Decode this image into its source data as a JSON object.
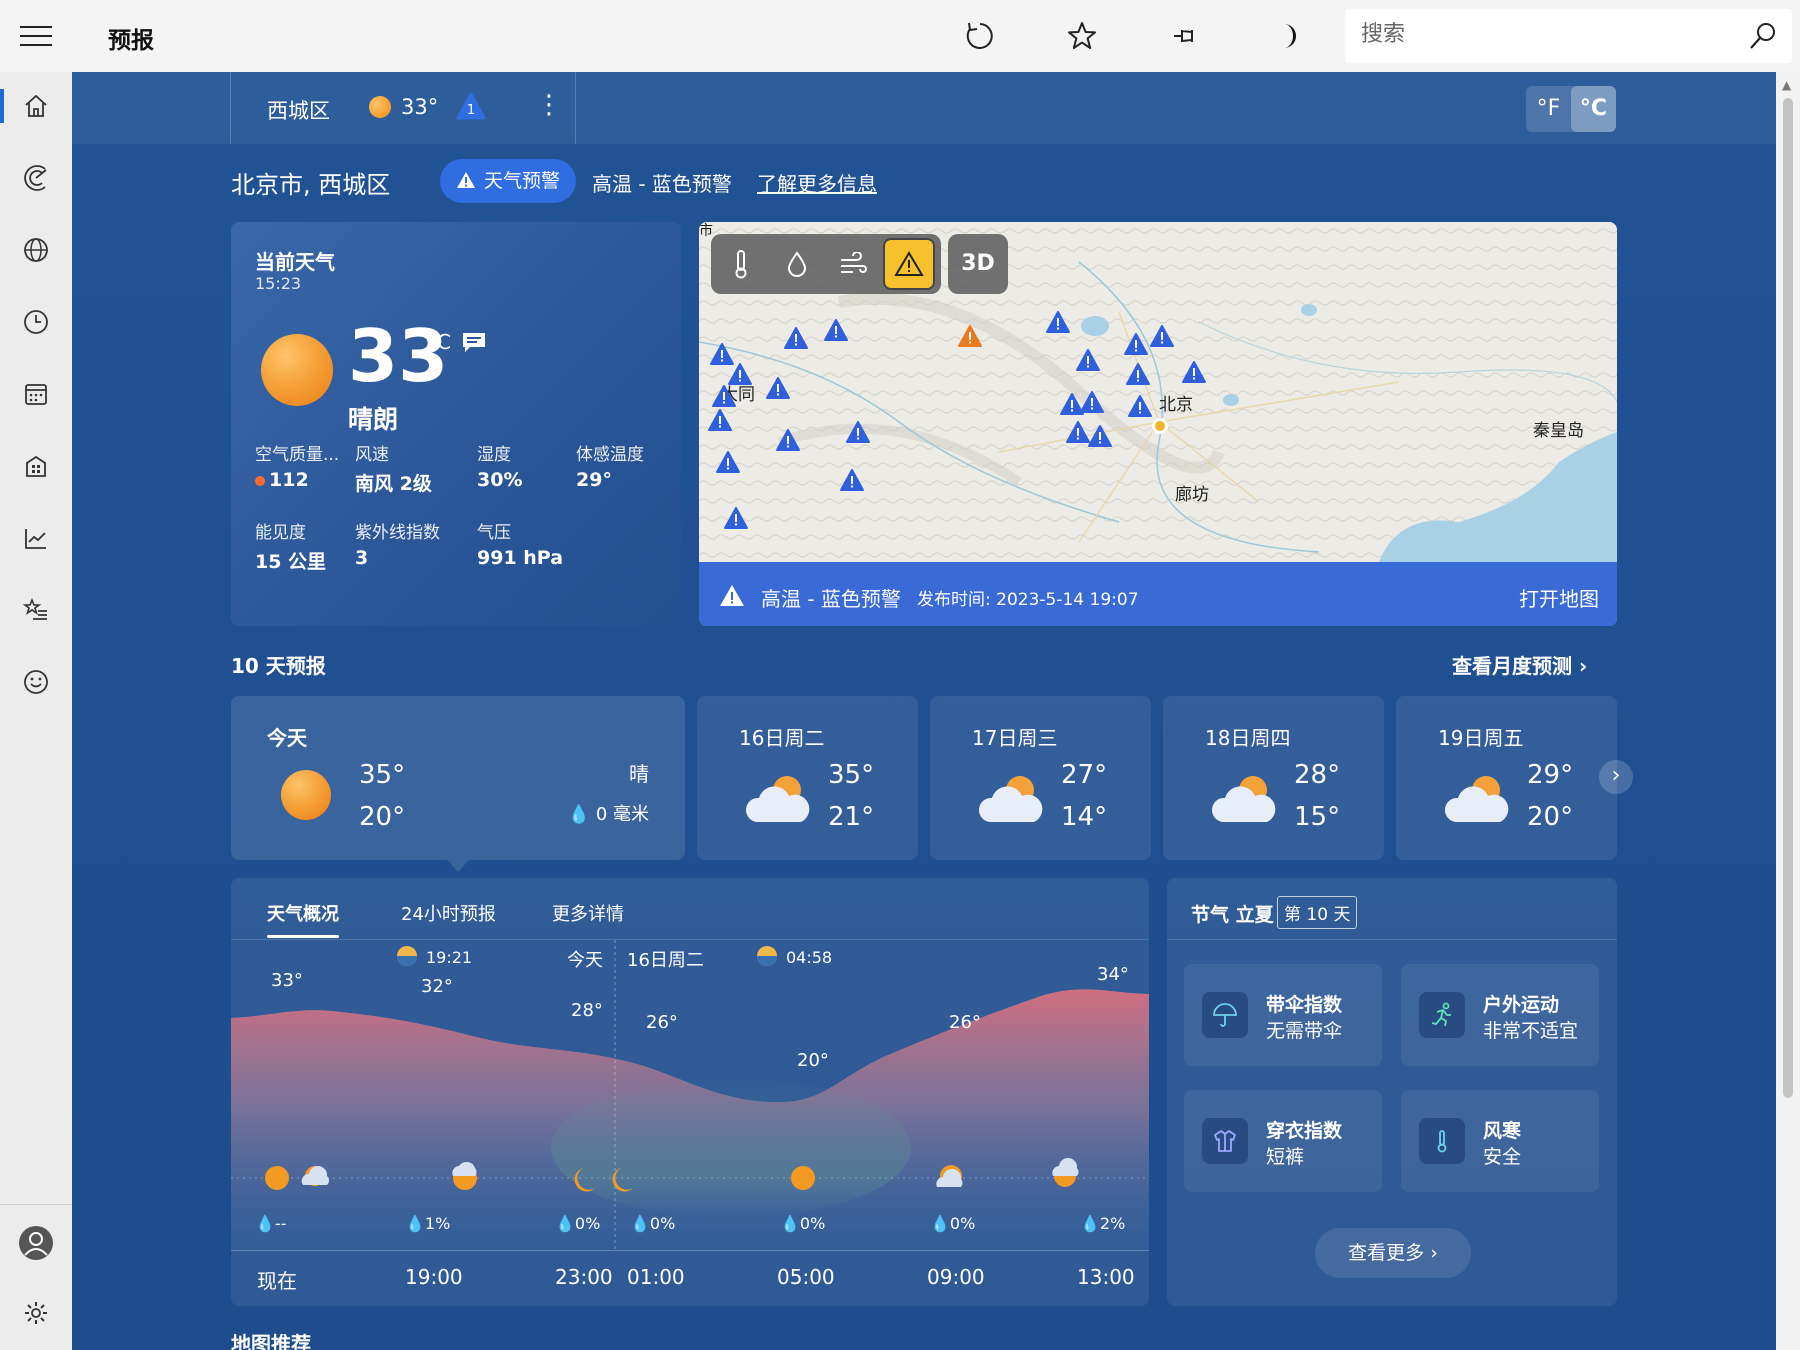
{
  "app": {
    "title": "预报"
  },
  "search": {
    "placeholder": "搜索"
  },
  "toolbar": {
    "icons": [
      "refresh-icon",
      "star-icon",
      "pin-icon",
      "moon-icon"
    ]
  },
  "nav": {
    "items": [
      "home-icon",
      "radar-icon",
      "globe-icon",
      "clock-icon",
      "calendar-icon",
      "building-icon",
      "chart-icon",
      "favorites-icon",
      "smile-icon"
    ],
    "bottom": [
      "avatar-icon",
      "gear-icon"
    ]
  },
  "location_bar": {
    "name": "西城区",
    "temp": "33°",
    "alert_count": "1",
    "unit_f": "°F",
    "unit_c": "°C"
  },
  "header": {
    "city": "北京市, 西城区",
    "alert_pill": "天气预警",
    "alert_text": "高温 - 蓝色预警",
    "alert_link": "了解更多信息"
  },
  "current": {
    "title": "当前天气",
    "time": "15:23",
    "temp": "33",
    "unit": "°C",
    "condition": "晴朗",
    "stats": [
      {
        "label": "空气质量...",
        "value": "112"
      },
      {
        "label": "风速",
        "value": "南风 2级"
      },
      {
        "label": "湿度",
        "value": "30%"
      },
      {
        "label": "体感温度",
        "value": "29°"
      },
      {
        "label": "能见度",
        "value": "15 公里"
      },
      {
        "label": "紫外线指数",
        "value": "3"
      },
      {
        "label": "气压",
        "value": "991 hPa"
      }
    ]
  },
  "map": {
    "tools": [
      "thermometer-icon",
      "drop-icon",
      "wind-icon",
      "warning-icon"
    ],
    "btn_3d": "3D",
    "labels": {
      "datong": "大同",
      "beijing": "北京",
      "langfang": "廊坊",
      "qinhuangdao": "秦皇岛",
      "edge": "市"
    },
    "alert_title": "高温 - 蓝色预警",
    "alert_time": "发布时间: 2023-5-14 19:07",
    "open": "打开地图"
  },
  "forecast": {
    "title": "10 天预报",
    "monthly_link": "查看月度预测",
    "today": {
      "name": "今天",
      "hi": "35°",
      "lo": "20°",
      "cond": "晴",
      "rain": "0 毫米"
    },
    "days": [
      {
        "name": "16日周二",
        "hi": "35°",
        "lo": "21°"
      },
      {
        "name": "17日周三",
        "hi": "27°",
        "lo": "14°"
      },
      {
        "name": "18日周四",
        "hi": "28°",
        "lo": "15°"
      },
      {
        "name": "19日周五",
        "hi": "29°",
        "lo": "20°"
      }
    ]
  },
  "overview": {
    "tabs": [
      "天气概况",
      "24小时预报",
      "更多详情"
    ],
    "sunset": "19:21",
    "today_label": "今天",
    "next_day": "16日周二",
    "sunrise": "04:58",
    "temps": [
      "33°",
      "32°",
      "28°",
      "26°",
      "20°",
      "26°",
      "34°"
    ],
    "precip": [
      "--",
      "1%",
      "0%",
      "0%",
      "0%",
      "0%",
      "2%"
    ],
    "hours": [
      "现在",
      "19:00",
      "23:00",
      "01:00",
      "05:00",
      "09:00",
      "13:00"
    ]
  },
  "solar_term": {
    "title": "节气 立夏",
    "day": "第 10 天",
    "items": [
      {
        "title": "带伞指数",
        "sub": "无需带伞",
        "icon": "umbrella-icon"
      },
      {
        "title": "户外运动",
        "sub": "非常不适宜",
        "icon": "runner-icon"
      },
      {
        "title": "穿衣指数",
        "sub": "短裤",
        "icon": "jacket-icon"
      },
      {
        "title": "风寒",
        "sub": "安全",
        "icon": "thermometer-icon"
      }
    ],
    "see_more": "查看更多"
  },
  "bottom": {
    "title": "地图推荐"
  }
}
